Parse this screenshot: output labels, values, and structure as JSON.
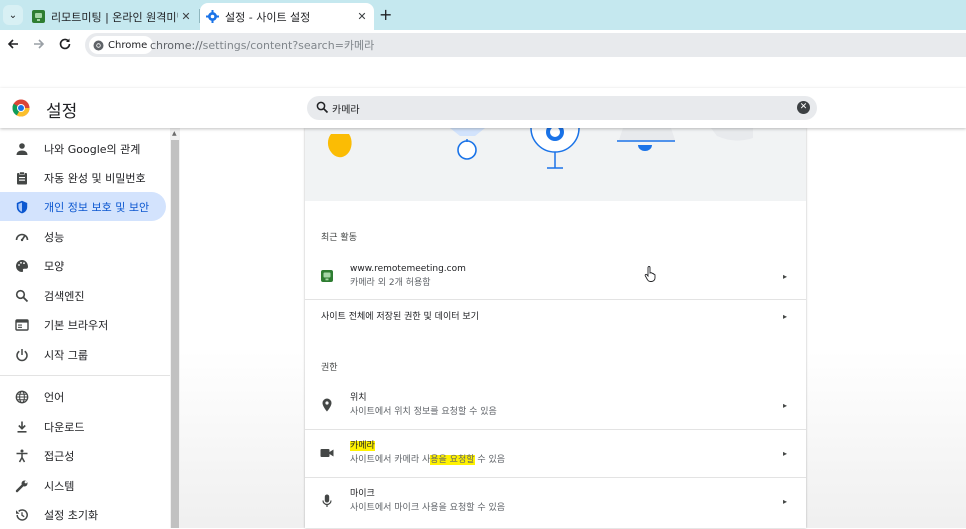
{
  "browser": {
    "tabs": [
      {
        "title": "리모트미팅 | 온라인 원격미팅",
        "active": false
      },
      {
        "title": "설정 - 사이트 설정",
        "active": true
      }
    ],
    "new_tab_label": "+",
    "tab_menu_label": "⌄",
    "close_label": "✕",
    "chip_label": "Chrome",
    "url_prefix": "chrome://",
    "url_rest": "settings/content?search=카메라",
    "url_query": ""
  },
  "header": {
    "title": "설정",
    "search_value": "카메라",
    "clear_label": "✕"
  },
  "sidebar": {
    "items": [
      {
        "label": "나와 Google의 관계",
        "icon": "person-icon"
      },
      {
        "label": "자동 완성 및 비밀번호",
        "icon": "clipboard-icon"
      },
      {
        "label": "개인 정보 보호 및 보안",
        "icon": "shield-icon",
        "active": true
      },
      {
        "label": "성능",
        "icon": "speedometer-icon"
      },
      {
        "label": "모양",
        "icon": "palette-icon"
      },
      {
        "label": "검색엔진",
        "icon": "search-icon"
      },
      {
        "label": "기본 브라우저",
        "icon": "browser-icon"
      },
      {
        "label": "시작 그룹",
        "icon": "power-icon"
      },
      {
        "label": "언어",
        "icon": "globe-icon"
      },
      {
        "label": "다운로드",
        "icon": "download-icon"
      },
      {
        "label": "접근성",
        "icon": "accessibility-icon"
      },
      {
        "label": "시스템",
        "icon": "wrench-icon"
      },
      {
        "label": "설정 초기화",
        "icon": "history-icon"
      }
    ]
  },
  "main": {
    "recent_label": "최근 활동",
    "recent_site": {
      "name": "www.remotemeeting.com",
      "desc": "카메라 외 2개 허용함"
    },
    "view_all_label": "사이트 전체에 저장된 권한 및 데이터 보기",
    "permissions_label": "권한",
    "permissions": {
      "location": {
        "title": "위치",
        "desc": "사이트에서 위치 정보를 요청할 수 있음"
      },
      "camera": {
        "title": "카메라",
        "desc_a": "사이트에서 카메라 사",
        "desc_hl": "용을 요청할",
        "desc_b": " 수 있음"
      },
      "mic": {
        "title": "마이크",
        "desc": "사이트에서 마이크 사용을 요청할 수 있음"
      }
    },
    "arrow": "▸"
  },
  "colors": {
    "tabstrip": "#c5e8ef",
    "accent": "#0b57d0",
    "active_nav": "#d3e3fd",
    "highlight": "#fff200"
  }
}
